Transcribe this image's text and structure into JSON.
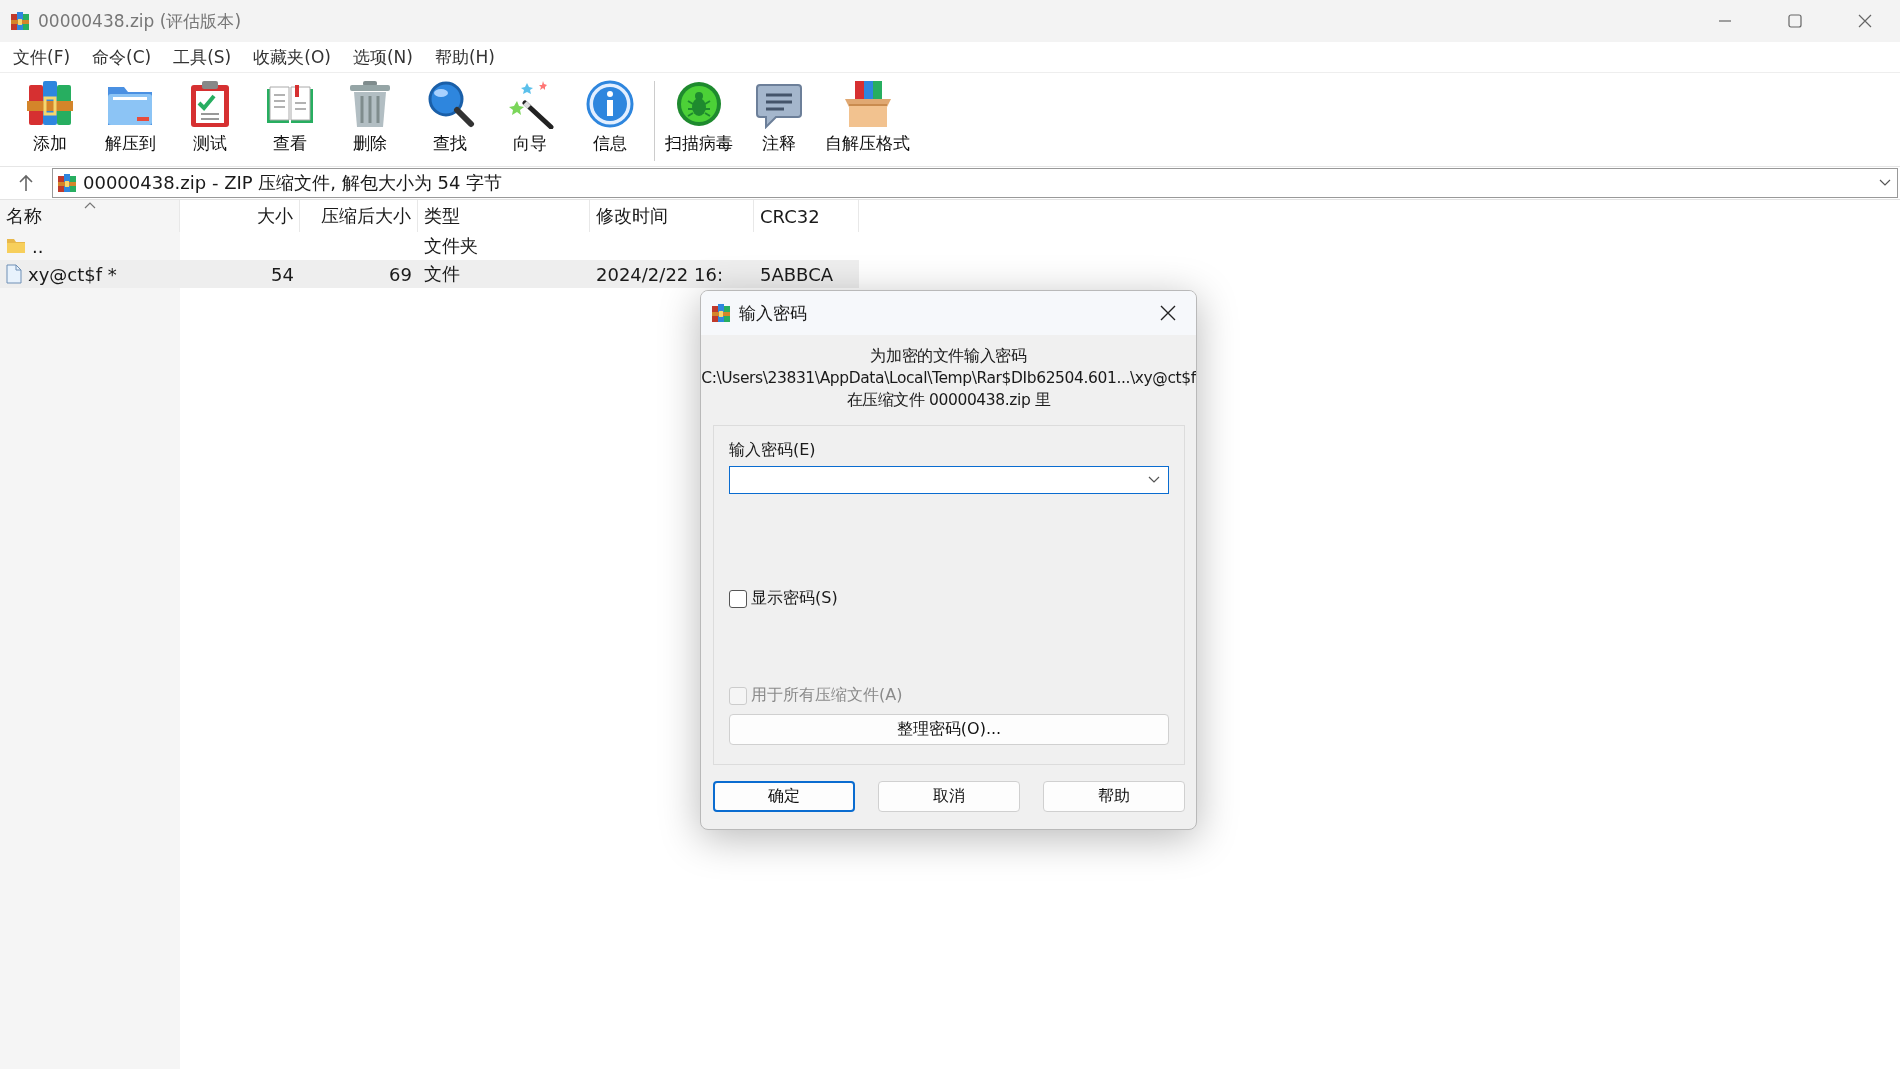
{
  "window": {
    "title": "00000438.zip (评估版本)"
  },
  "menu": [
    "文件(F)",
    "命令(C)",
    "工具(S)",
    "收藏夹(O)",
    "选项(N)",
    "帮助(H)"
  ],
  "toolbar": {
    "groups": [
      [
        "添加",
        "解压到",
        "测试",
        "查看",
        "删除",
        "查找",
        "向导",
        "信息"
      ],
      [
        "扫描病毒",
        "注释",
        "自解压格式"
      ]
    ]
  },
  "address_bar": {
    "text": "00000438.zip - ZIP 压缩文件, 解包大小为 54 字节"
  },
  "file_list": {
    "columns": [
      {
        "label": "名称",
        "sorted": true
      },
      {
        "label": "大小",
        "sorted": false
      },
      {
        "label": "压缩后大小",
        "sorted": false
      },
      {
        "label": "类型",
        "sorted": false
      },
      {
        "label": "修改时间",
        "sorted": false
      },
      {
        "label": "CRC32",
        "sorted": false
      }
    ],
    "rows": [
      {
        "kind": "folder",
        "selected": false,
        "cells": [
          "..",
          "",
          "",
          "文件夹",
          "",
          ""
        ]
      },
      {
        "kind": "file",
        "selected": true,
        "cells": [
          "xy@ct$f *",
          "54",
          "69",
          "文件",
          "2024/2/22 16:",
          "5ABBCA"
        ]
      }
    ]
  },
  "dialog": {
    "title": "输入密码",
    "message": [
      "为加密的文件输入密码",
      "C:\\Users\\23831\\AppData\\Local\\Temp\\Rar$DIb62504.601...\\xy@ct$f",
      "在压缩文件 00000438.zip 里"
    ],
    "password_label": "输入密码(E)",
    "options": [
      {
        "label": "显示密码(S)",
        "checked": false,
        "disabled": false
      },
      {
        "label": "用于所有压缩文件(A)",
        "checked": false,
        "disabled": true
      }
    ],
    "organize_button": "整理密码(O)...",
    "buttons": [
      {
        "label": "确定",
        "default": true
      },
      {
        "label": "取消",
        "default": false
      },
      {
        "label": "帮助",
        "default": false
      }
    ]
  }
}
